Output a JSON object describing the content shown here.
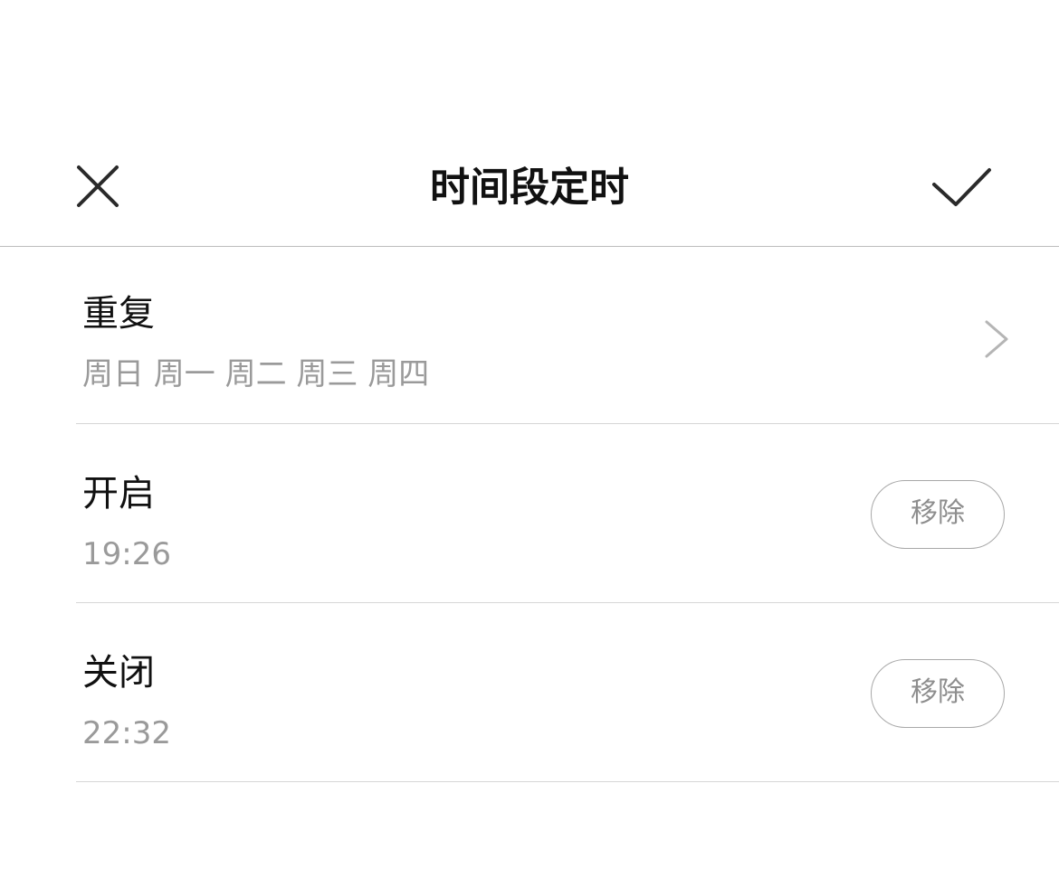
{
  "header": {
    "title": "时间段定时",
    "close_icon": "close-icon",
    "confirm_icon": "checkmark-icon"
  },
  "repeat": {
    "label": "重复",
    "days": "周日 周一 周二 周三 周四",
    "chevron_icon": "chevron-right-icon"
  },
  "open": {
    "label": "开启",
    "time": "19:26",
    "remove_label": "移除"
  },
  "close": {
    "label": "关闭",
    "time": "22:32",
    "remove_label": "移除"
  },
  "colors": {
    "primary_text": "#111111",
    "secondary_text": "#9a9a9a",
    "divider": "#d6d6d6",
    "button_border": "#a8a8a8"
  }
}
